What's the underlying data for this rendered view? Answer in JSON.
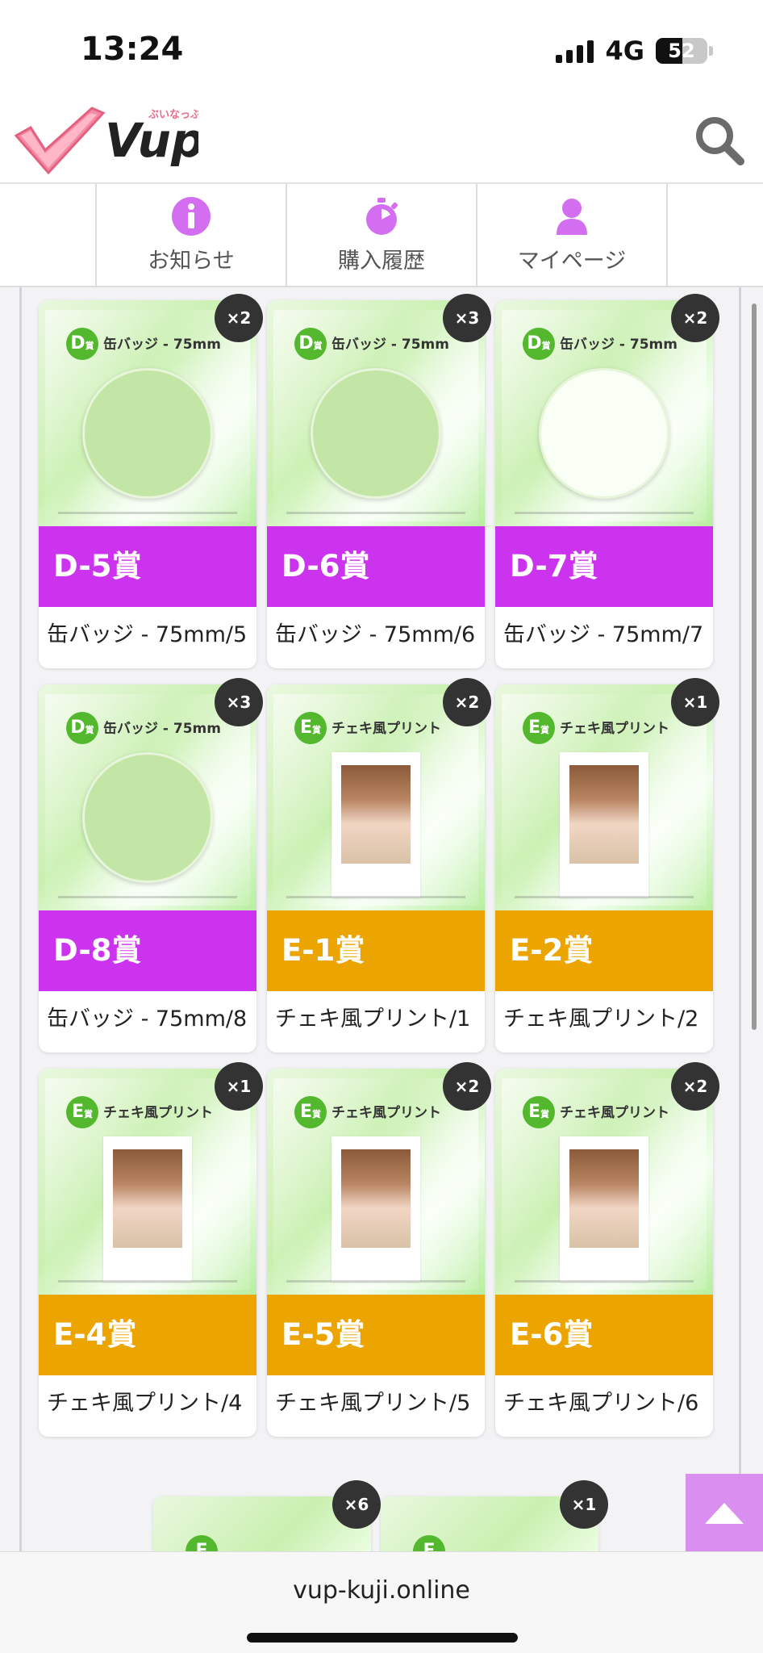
{
  "status_bar": {
    "time": "13:24",
    "network": "4G",
    "battery": "52",
    "battery_level": 0.52
  },
  "header": {
    "logo_text": "Vup",
    "logo_sub": "ぶいなっぷ",
    "search_icon": "search-icon"
  },
  "nav": {
    "items": [
      {
        "label": "お知らせ",
        "icon": "info-icon"
      },
      {
        "label": "購入履歴",
        "icon": "stopwatch-icon"
      },
      {
        "label": "マイページ",
        "icon": "user-icon"
      }
    ]
  },
  "colors": {
    "purple_band": "#cc33ee",
    "orange_band": "#eba400",
    "grade_green": "#53b82e",
    "accent_pink": "#d98ef0"
  },
  "cards": [
    {
      "count": "×2",
      "grade": "D",
      "grade_suffix": "賞",
      "image_title": "缶バッジ - 75mm",
      "prize": "D-5賞",
      "desc": "缶バッジ - 75mm/5",
      "band": "purple",
      "art": "badge"
    },
    {
      "count": "×3",
      "grade": "D",
      "grade_suffix": "賞",
      "image_title": "缶バッジ - 75mm",
      "prize": "D-6賞",
      "desc": "缶バッジ - 75mm/6",
      "band": "purple",
      "art": "badge"
    },
    {
      "count": "×2",
      "grade": "D",
      "grade_suffix": "賞",
      "image_title": "缶バッジ - 75mm",
      "prize": "D-7賞",
      "desc": "缶バッジ - 75mm/7",
      "band": "purple",
      "art": "badge-white"
    },
    {
      "count": "×3",
      "grade": "D",
      "grade_suffix": "賞",
      "image_title": "缶バッジ - 75mm",
      "prize": "D-8賞",
      "desc": "缶バッジ - 75mm/8",
      "band": "purple",
      "art": "badge"
    },
    {
      "count": "×2",
      "grade": "E",
      "grade_suffix": "賞",
      "image_title": "チェキ風プリント",
      "prize": "E-1賞",
      "desc": "チェキ風プリント/1",
      "band": "orange",
      "art": "cheki"
    },
    {
      "count": "×1",
      "grade": "E",
      "grade_suffix": "賞",
      "image_title": "チェキ風プリント",
      "prize": "E-2賞",
      "desc": "チェキ風プリント/2",
      "band": "orange",
      "art": "cheki"
    },
    {
      "count": "×1",
      "grade": "E",
      "grade_suffix": "賞",
      "image_title": "チェキ風プリント",
      "prize": "E-4賞",
      "desc": "チェキ風プリント/4",
      "band": "orange",
      "art": "cheki"
    },
    {
      "count": "×2",
      "grade": "E",
      "grade_suffix": "賞",
      "image_title": "チェキ風プリント",
      "prize": "E-5賞",
      "desc": "チェキ風プリント/5",
      "band": "orange",
      "art": "cheki"
    },
    {
      "count": "×2",
      "grade": "E",
      "grade_suffix": "賞",
      "image_title": "チェキ風プリント",
      "prize": "E-6賞",
      "desc": "チェキ風プリント/6",
      "band": "orange",
      "art": "cheki"
    }
  ],
  "partial_cards": [
    {
      "count": "×6",
      "grade": "E"
    },
    {
      "count": "×1",
      "grade": "E"
    }
  ],
  "browser": {
    "url": "vup-kuji.online"
  }
}
